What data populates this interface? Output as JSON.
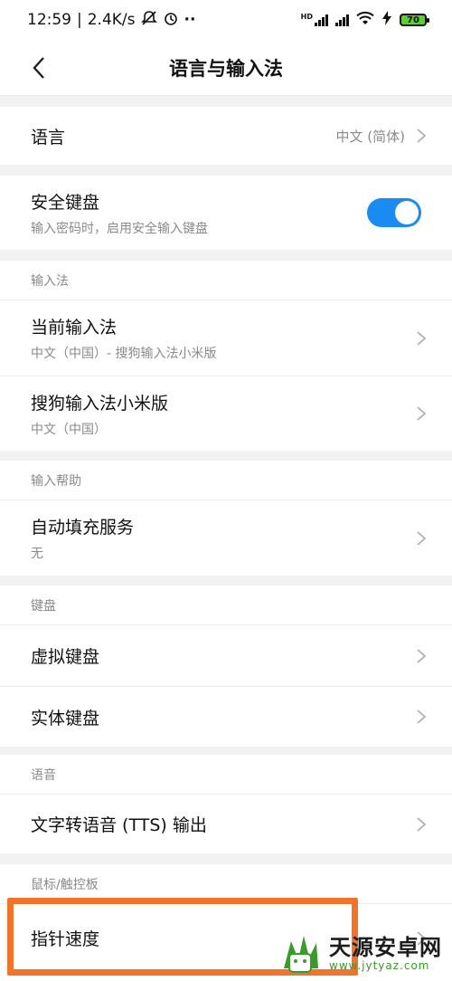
{
  "status_bar": {
    "time": "12:59",
    "separator": "|",
    "network_speed": "2.4K/s",
    "silent_icon": "mute-bell-icon",
    "alarm_icon": "alarm-icon",
    "more_dots": "··",
    "hd_label": "HD",
    "wifi_icon": "wifi-icon",
    "charging_icon": "bolt-icon",
    "battery": "70"
  },
  "nav": {
    "back_icon": "chevron-left-icon",
    "title": "语言与输入法"
  },
  "language": {
    "label": "语言",
    "value": "中文 (简体)"
  },
  "secure_keyboard": {
    "label": "安全键盘",
    "description": "输入密码时，启用安全输入键盘",
    "enabled": true,
    "accent_color": "#1a8bf0"
  },
  "input_method_section": {
    "header": "输入法",
    "items": [
      {
        "label": "当前输入法",
        "sub": "中文（中国）- 搜狗输入法小米版"
      },
      {
        "label": "搜狗输入法小米版",
        "sub": "中文（中国）"
      }
    ]
  },
  "input_help_section": {
    "header": "输入帮助",
    "items": [
      {
        "label": "自动填充服务",
        "sub": "无"
      }
    ]
  },
  "keyboard_section": {
    "header": "键盘",
    "items": [
      {
        "label": "虚拟键盘"
      },
      {
        "label": "实体键盘"
      }
    ]
  },
  "voice_section": {
    "header": "语音",
    "items": [
      {
        "label": "文字转语音 (TTS) 输出"
      }
    ]
  },
  "pointer_section": {
    "header": "鼠标/触控板",
    "items": [
      {
        "label": "指针速度"
      }
    ]
  },
  "highlight_color": "#f0742a",
  "watermark": {
    "title": "天源安卓网",
    "url": "www.jytyaz.com"
  }
}
